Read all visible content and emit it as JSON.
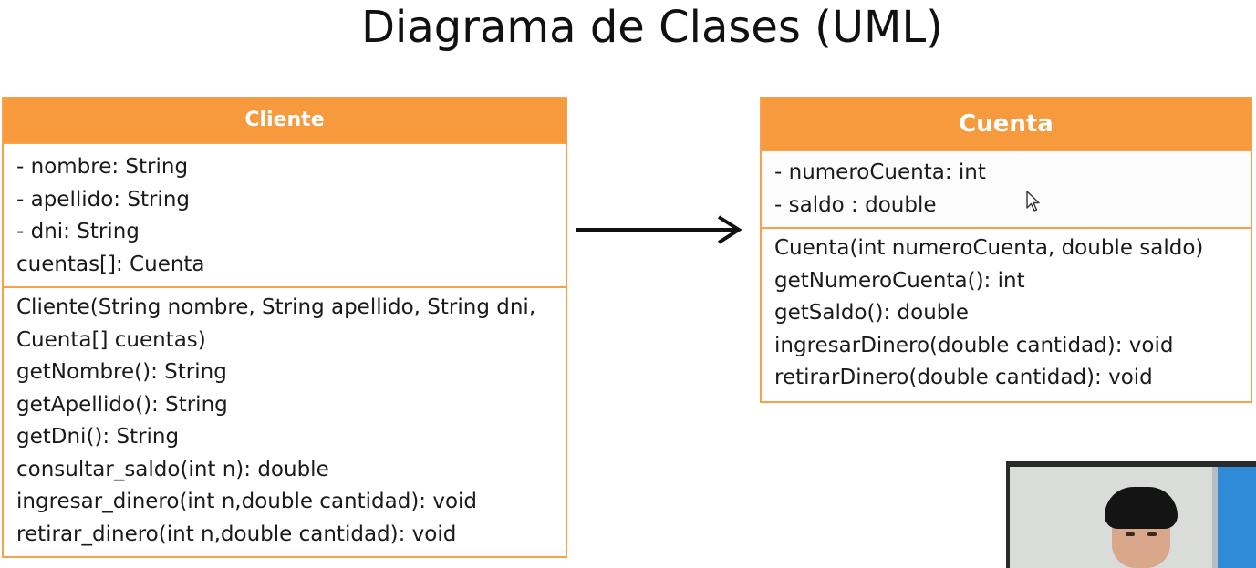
{
  "title": "Diagrama de Clases (UML)",
  "classes": {
    "cliente": {
      "name": "Cliente",
      "attributes": [
        "- nombre: String",
        "- apellido: String",
        "- dni: String",
        "cuentas[]: Cuenta"
      ],
      "operations": [
        "Cliente(String nombre, String apellido, String dni,",
        "Cuenta[] cuentas)",
        "getNombre(): String",
        "getApellido(): String",
        "getDni(): String",
        "consultar_saldo(int n): double",
        "ingresar_dinero(int n,double cantidad): void",
        "retirar_dinero(int n,double cantidad): void"
      ]
    },
    "cuenta": {
      "name": "Cuenta",
      "attributes": [
        "- numeroCuenta: int",
        "- saldo : double"
      ],
      "operations": [
        "Cuenta(int numeroCuenta, double saldo)",
        "getNumeroCuenta(): int",
        "getSaldo(): double",
        "ingresarDinero(double cantidad): void",
        "retirarDinero(double cantidad): void"
      ]
    }
  },
  "colors": {
    "header": "#f79a3e",
    "border": "#f7a24a",
    "header_text": "#ffffff"
  },
  "icons": {
    "association": "arrow-right-icon",
    "pointer": "mouse-cursor-icon"
  }
}
